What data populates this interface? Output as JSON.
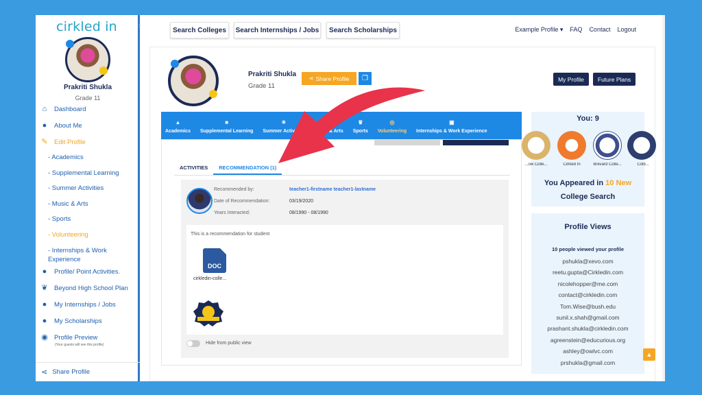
{
  "brand": {
    "logo_text": "cirkled in"
  },
  "sidebar": {
    "name": "Prakriti Shukla",
    "grade": "Grade 11",
    "items": [
      {
        "label": "Dashboard",
        "icon": "home-icon"
      },
      {
        "label": "About Me",
        "icon": "user-icon"
      },
      {
        "label": "Edit Profile",
        "icon": "edit-icon",
        "active": true
      },
      {
        "label": "- Academics"
      },
      {
        "label": "- Supplemental Learning"
      },
      {
        "label": "- Summer Activities"
      },
      {
        "label": "- Music & Arts"
      },
      {
        "label": "- Sports"
      },
      {
        "label": "- Volunteering",
        "active": true
      },
      {
        "label": "- Internships & Work Experience"
      },
      {
        "label": "Profile/ Point Activities.",
        "icon": "users-icon"
      },
      {
        "label": "Beyond High School Plan",
        "icon": "leaf-icon"
      },
      {
        "label": "My Internships / Jobs",
        "icon": "users-icon"
      },
      {
        "label": "My Scholarships",
        "icon": "user-icon"
      },
      {
        "label": "Profile Preview",
        "icon": "eye-icon"
      }
    ],
    "preview_note": "(Your guests will see this profile)",
    "share_profile": "Share Profile"
  },
  "topbar": {
    "buttons": [
      "Search Colleges",
      "Search Internships / Jobs",
      "Search Scholarships"
    ],
    "links": [
      "Example Profile ▾",
      "FAQ",
      "Contact",
      "Logout"
    ]
  },
  "profile": {
    "name": "Prakriti Shukla",
    "grade": "Grade 11",
    "share_label": "Share Profile",
    "my_profile": "My Profile",
    "future_plans": "Future Plans"
  },
  "tabs": [
    {
      "label": "Academics",
      "icon": "graduation-cap-icon"
    },
    {
      "label": "Supplemental Learning",
      "icon": "book-icon"
    },
    {
      "label": "Summer Activities",
      "icon": "sun-icon"
    },
    {
      "label": "Music & Arts",
      "icon": "music-icon"
    },
    {
      "label": "Sports",
      "icon": "trophy-icon"
    },
    {
      "label": "Volunteering",
      "icon": "handshake-icon",
      "active": true
    },
    {
      "label": "Internships & Work Experience",
      "icon": "briefcase-icon"
    }
  ],
  "subtabs": {
    "activities": "ACTIVITIES",
    "recommendation": "RECOMMENDATION (1)"
  },
  "recommendation": {
    "recommended_by_label": "Recommended by:",
    "recommended_by": "teacher1-firstname teacher1-lastname",
    "date_label": "Date of Recommendation:",
    "date": "03/19/2020",
    "years_label": "Years Interacted:",
    "years": "08/1990 - 08/1990",
    "text": "This is a recommendation for student",
    "doc_type": "DOC",
    "doc_name": "cirkledin-colle...",
    "hide_label": "Hide from public view"
  },
  "college_panel": {
    "you_label": "You: 9",
    "colleges": [
      {
        "name": "...ow Colle...",
        "color": "#d9b46a"
      },
      {
        "name": "Cirkled In",
        "color": "#f07a2e"
      },
      {
        "name": "Brevard Colle...",
        "color": "#3d4f8f"
      },
      {
        "name": "Colb...",
        "color": "#2c3e6e"
      }
    ],
    "appeared_prefix": "You Appeared in",
    "appeared_count": "10 New",
    "appeared_suffix": "College Search"
  },
  "views_panel": {
    "title": "Profile Views",
    "subtitle": "10 people viewed your profile",
    "emails": [
      "pshukla@xevo.com",
      "reetu.gupta@Cirkledin.com",
      "nicolehopper@me.com",
      "contact@cirkledin.com",
      "Tom.Wise@bush.edu",
      "sunil.x.shah@gmail.com",
      "prashant.shukla@cirkledin.com",
      "agreenstein@educurious.org",
      "ashley@owlvc.com",
      "prshukla@gmail.com"
    ]
  },
  "colors": {
    "primary": "#1e88e5",
    "navy": "#1b2a55",
    "accent": "#f5a623",
    "arrow": "#e8334a",
    "background": "#3b9be0"
  }
}
